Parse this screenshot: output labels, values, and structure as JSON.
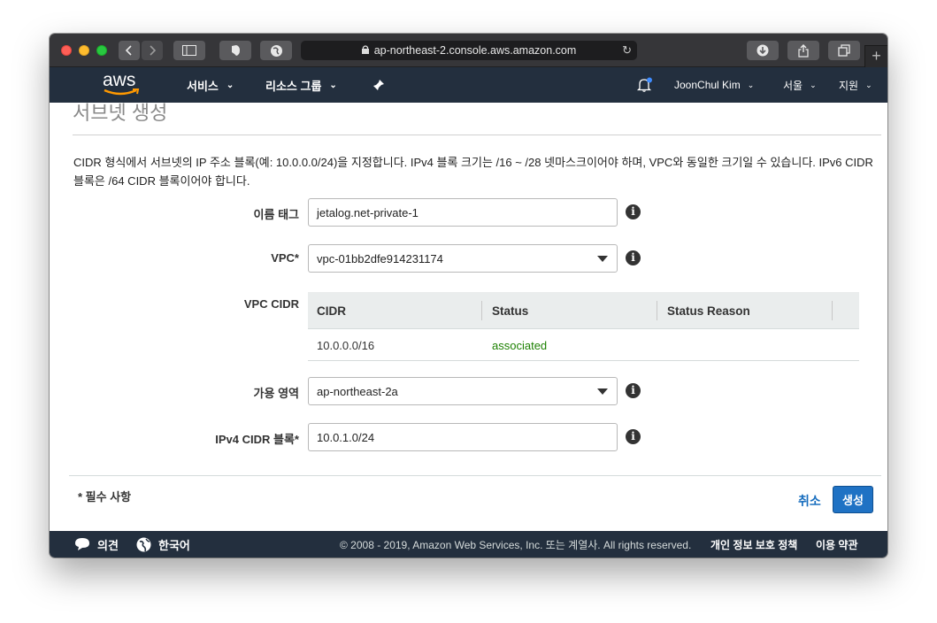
{
  "browser": {
    "url": "ap-northeast-2.console.aws.amazon.com",
    "new_tab": "+"
  },
  "aws_nav": {
    "logo": "aws",
    "services": "서비스",
    "resource_groups": "리소스 그룹",
    "user": "JoonChul Kim",
    "region": "서울",
    "support": "지원"
  },
  "page": {
    "title": "서브넷 생성",
    "description": "CIDR 형식에서 서브넷의 IP 주소 블록(예: 10.0.0.0/24)을 지정합니다. IPv4 블록 크기는 /16 ~ /28 넷마스크이어야 하며, VPC와 동일한 크기일 수 있습니다. IPv6 CIDR 블록은 /64 CIDR 블록이어야 합니다.",
    "form": {
      "name_tag_label": "이름 태그",
      "name_tag_value": "jetalog.net-private-1",
      "vpc_label": "VPC*",
      "vpc_value": "vpc-01bb2dfe914231174",
      "vpc_cidr_label": "VPC CIDR",
      "az_label": "가용 영역",
      "az_value": "ap-northeast-2a",
      "ipv4_label": "IPv4 CIDR 블록*",
      "ipv4_value": "10.0.1.0/24"
    },
    "cidr_table": {
      "headers": [
        "CIDR",
        "Status",
        "Status Reason"
      ],
      "rows": [
        {
          "cidr": "10.0.0.0/16",
          "status": "associated",
          "reason": ""
        }
      ]
    },
    "required_note": "* 필수 사항",
    "cancel_label": "취소",
    "create_label": "생성"
  },
  "footer": {
    "feedback": "의견",
    "language": "한국어",
    "copyright": "© 2008 - 2019, Amazon Web Services, Inc. 또는 계열사. All rights reserved.",
    "privacy": "개인 정보 보호 정책",
    "terms": "이용 약관"
  },
  "colors": {
    "aws_nav_bg": "#232f3e",
    "status_associated": "#1d8102",
    "primary_button": "#1f72c4",
    "link": "#1a6fbf",
    "notification_dot": "#3f8cff"
  }
}
